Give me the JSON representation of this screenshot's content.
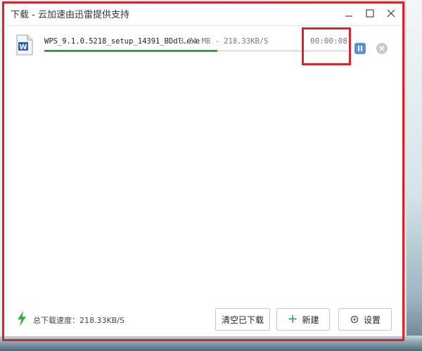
{
  "window": {
    "title": "下载 - 云加速由迅雷提供支持"
  },
  "downloads": [
    {
      "file_name": "WPS_9.1.0.5218_setup_14391_BDdl.exe",
      "size_speed": "3.74 MB - 218.33KB/S",
      "time_remaining": "00:00:08",
      "progress": 0.57,
      "file_icon": "word-document-icon"
    }
  ],
  "footer": {
    "speed_label": "总下载速度：218.33KB/S",
    "clear_button": "清空已下载",
    "new_button": "新建",
    "settings_button": "设置"
  },
  "colors": {
    "progress": "#2aa24a",
    "accent_blue": "#5b8fd6",
    "highlight_red": "#d9232d"
  }
}
